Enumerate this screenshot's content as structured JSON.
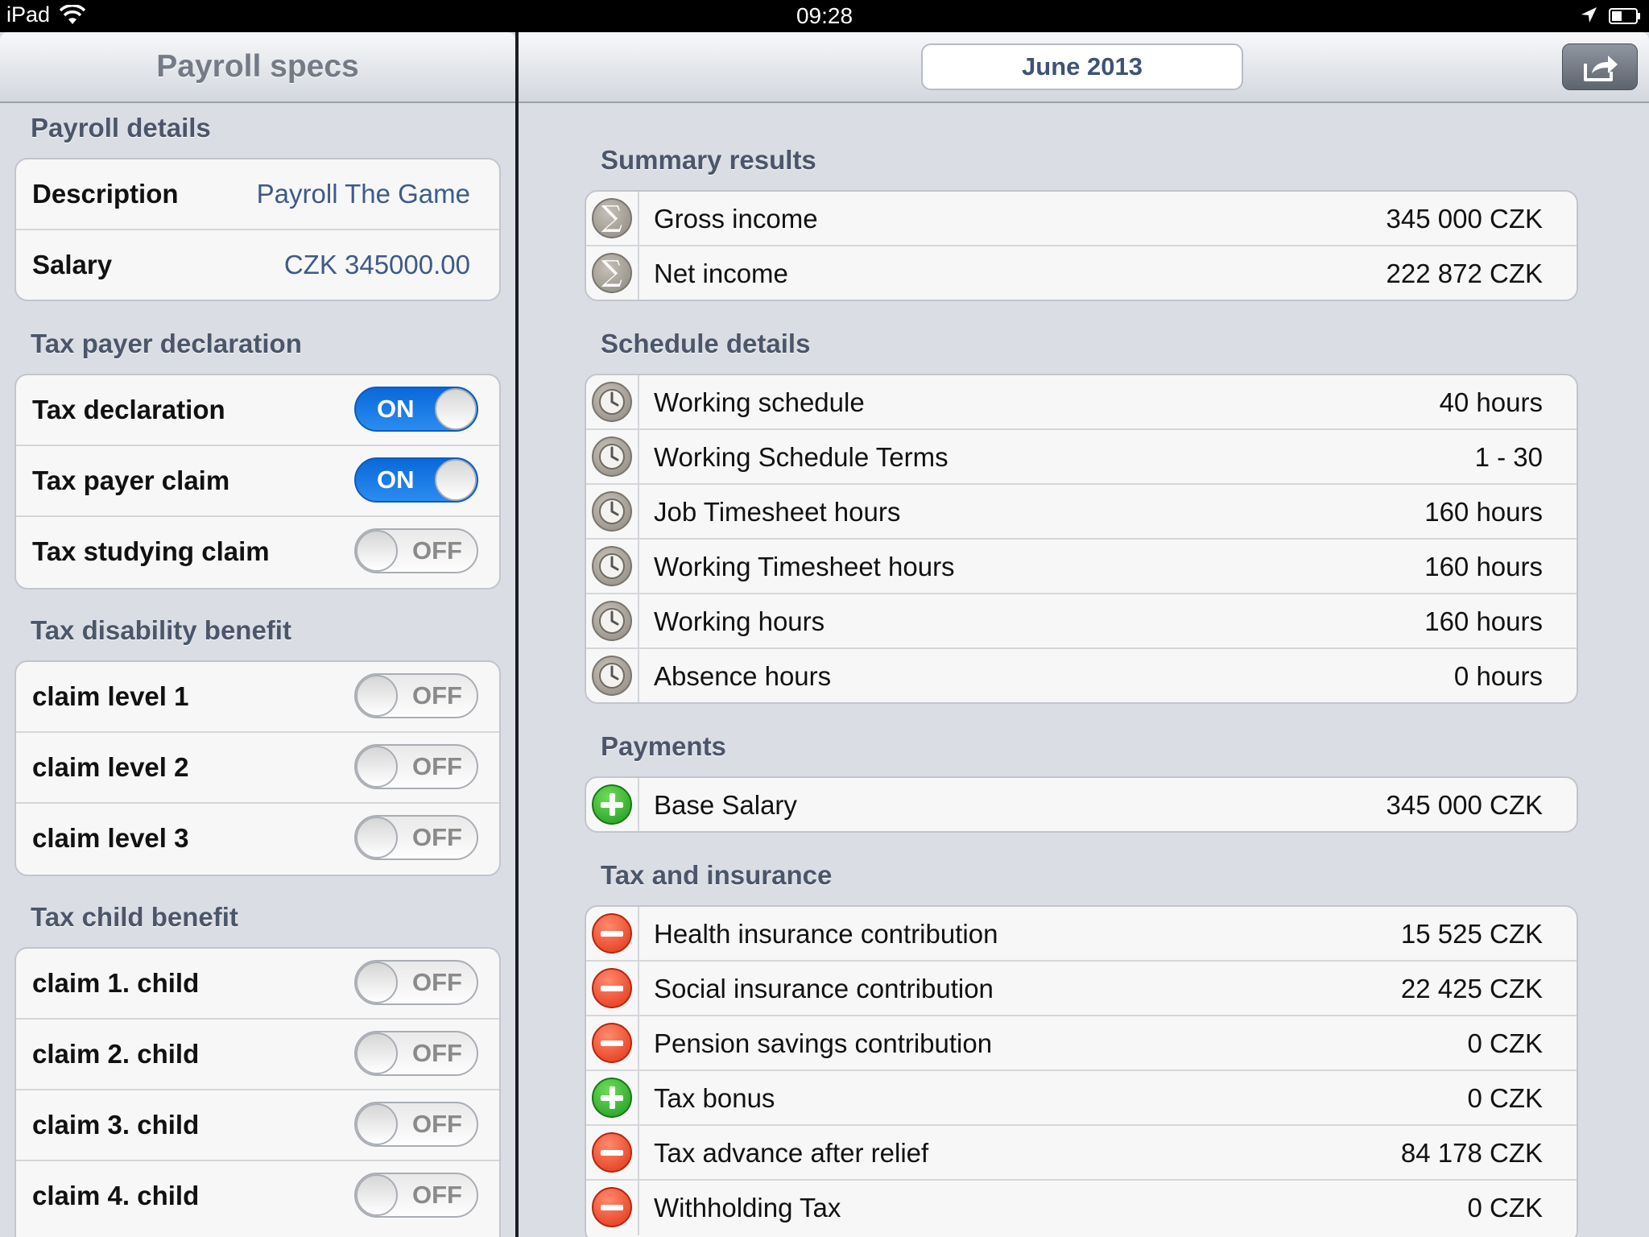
{
  "status_bar": {
    "device": "iPad",
    "time": "09:28"
  },
  "left": {
    "title": "Payroll specs",
    "payroll_details": {
      "header": "Payroll details",
      "rows": [
        {
          "label": "Description",
          "value": "Payroll The Game"
        },
        {
          "label": "Salary",
          "value": "CZK 345000.00"
        }
      ]
    },
    "tax_payer_declaration": {
      "header": "Tax payer declaration",
      "rows": [
        {
          "label": "Tax declaration",
          "state": "ON"
        },
        {
          "label": "Tax payer claim",
          "state": "ON"
        },
        {
          "label": "Tax studying claim",
          "state": "OFF"
        }
      ]
    },
    "tax_disability_benefit": {
      "header": "Tax disability benefit",
      "rows": [
        {
          "label": "claim level 1",
          "state": "OFF"
        },
        {
          "label": "claim level 2",
          "state": "OFF"
        },
        {
          "label": "claim level 3",
          "state": "OFF"
        }
      ]
    },
    "tax_child_benefit": {
      "header": "Tax child benefit",
      "rows": [
        {
          "label": "claim 1. child",
          "state": "OFF"
        },
        {
          "label": "claim 2. child",
          "state": "OFF"
        },
        {
          "label": "claim 3. child",
          "state": "OFF"
        },
        {
          "label": "claim 4. child",
          "state": "OFF"
        }
      ]
    }
  },
  "right": {
    "period": "June 2013",
    "share_icon": "share-icon",
    "summary": {
      "header": "Summary results",
      "rows": [
        {
          "icon": "sigma",
          "label": "Gross income",
          "value": "345 000 CZK"
        },
        {
          "icon": "sigma",
          "label": "Net income",
          "value": "222 872 CZK"
        }
      ]
    },
    "schedule": {
      "header": "Schedule details",
      "rows": [
        {
          "icon": "clock",
          "label": "Working schedule",
          "value": "40 hours"
        },
        {
          "icon": "clock",
          "label": "Working Schedule Terms",
          "value": "1 - 30"
        },
        {
          "icon": "clock",
          "label": "Job Timesheet hours",
          "value": "160 hours"
        },
        {
          "icon": "clock",
          "label": "Working Timesheet hours",
          "value": "160 hours"
        },
        {
          "icon": "clock",
          "label": "Working hours",
          "value": "160 hours"
        },
        {
          "icon": "clock",
          "label": "Absence hours",
          "value": "0 hours"
        }
      ]
    },
    "payments": {
      "header": "Payments",
      "rows": [
        {
          "icon": "plus",
          "label": "Base Salary",
          "value": "345 000 CZK"
        }
      ]
    },
    "tax_insurance": {
      "header": "Tax and insurance",
      "rows": [
        {
          "icon": "minus",
          "label": "Health insurance contribution",
          "value": "15 525 CZK"
        },
        {
          "icon": "minus",
          "label": "Social insurance contribution",
          "value": "22 425 CZK"
        },
        {
          "icon": "minus",
          "label": "Pension savings contribution",
          "value": "0 CZK"
        },
        {
          "icon": "plus",
          "label": "Tax bonus",
          "value": "0 CZK"
        },
        {
          "icon": "minus",
          "label": "Tax advance after relief",
          "value": "84 178 CZK"
        },
        {
          "icon": "minus",
          "label": "Withholding Tax",
          "value": "0 CZK"
        }
      ]
    }
  }
}
